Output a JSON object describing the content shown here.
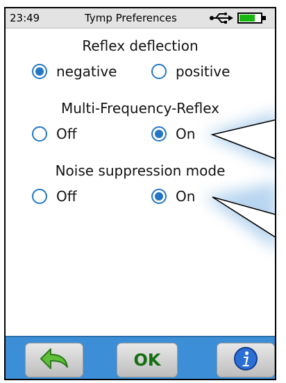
{
  "status": {
    "time": "23:49",
    "title": "Tymp Preferences",
    "usb_icon": "usb-icon",
    "battery_icon": "battery-icon"
  },
  "reflex": {
    "heading": "Reflex deflection",
    "options": [
      {
        "label": "negative",
        "selected": true
      },
      {
        "label": "positive",
        "selected": false
      }
    ]
  },
  "multi": {
    "heading": "Multi-Frequency-Reflex",
    "options": [
      {
        "label": "Off",
        "selected": false
      },
      {
        "label": "On",
        "selected": true
      }
    ]
  },
  "noise": {
    "heading": "Noise suppression mode",
    "options": [
      {
        "label": "Off",
        "selected": false
      },
      {
        "label": "On",
        "selected": true
      }
    ]
  },
  "footer": {
    "back_icon": "back-arrow-icon",
    "ok_label": "OK",
    "info_icon": "info-icon"
  },
  "colors": {
    "accent": "#2276c4",
    "footer": "#3c8fd6",
    "ok_text": "#156f10",
    "battery": "#16b80f",
    "back_arrow": "#5fbf3a"
  }
}
